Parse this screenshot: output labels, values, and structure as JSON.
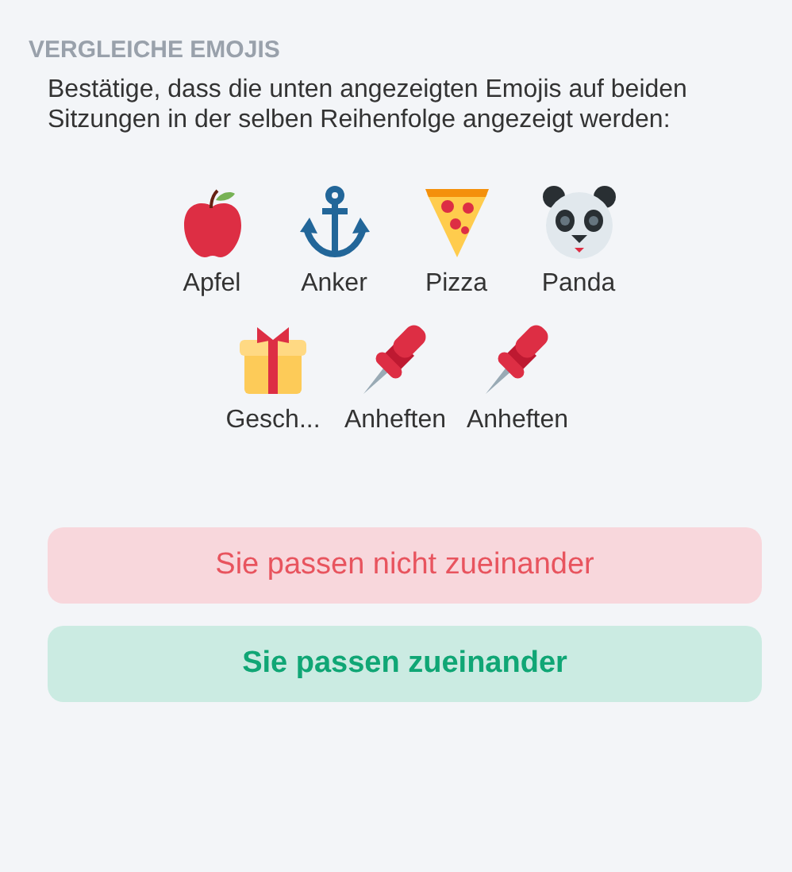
{
  "heading": "VERGLEICHE EMOJIS",
  "description": "Bestätige, dass die unten angezeigten Emojis auf beiden Sitzungen in der selben Reihenfolge angezeigt werden:",
  "emojis": [
    {
      "kind": "apple",
      "label": "Apfel"
    },
    {
      "kind": "anchor",
      "label": "Anker"
    },
    {
      "kind": "pizza",
      "label": "Pizza"
    },
    {
      "kind": "panda",
      "label": "Panda"
    },
    {
      "kind": "gift",
      "label": "Gesch..."
    },
    {
      "kind": "pin",
      "label": "Anheften"
    },
    {
      "kind": "pin",
      "label": "Anheften"
    }
  ],
  "buttons": [
    {
      "kind": "mismatch",
      "label": "Sie passen nicht zueinander"
    },
    {
      "kind": "match",
      "label": "Sie passen zueinander"
    }
  ]
}
